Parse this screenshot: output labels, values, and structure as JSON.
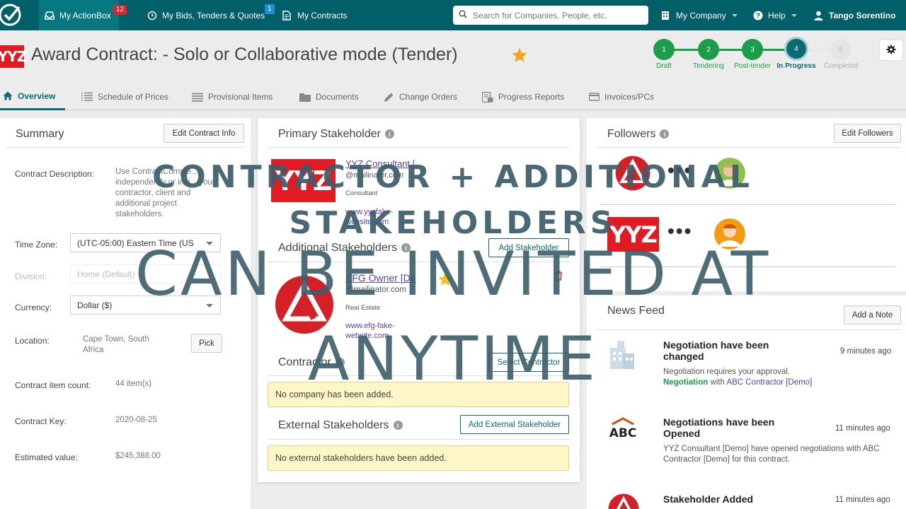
{
  "nav": {
    "action_box": "My ActionBox",
    "action_box_badge": "12",
    "bids": "My Bids, Tenders & Quotes",
    "bids_badge": "1",
    "contracts": "My Contracts",
    "search_placeholder": "Search for Companies, People, etc.",
    "company": "My Company",
    "help": "Help",
    "user": "Tango Sorentino"
  },
  "header": {
    "logo_text": "YYZ",
    "title": "Award Contract: - Solo or Collaborative mode (Tender)"
  },
  "steps": [
    {
      "num": "1",
      "label": "Draft"
    },
    {
      "num": "2",
      "label": "Tendering"
    },
    {
      "num": "3",
      "label": "Post-tender"
    },
    {
      "num": "4",
      "label": "In Progress"
    },
    {
      "num": "5",
      "label": "Completed"
    }
  ],
  "tabs": {
    "overview": "Overview",
    "schedule": "Schedule of Prices",
    "provisional": "Provisional Items",
    "documents": "Documents",
    "change_orders": "Change Orders",
    "progress": "Progress Reports",
    "invoices": "Invoices/PCs"
  },
  "summary": {
    "title": "Summary",
    "edit_button": "Edit Contract Info",
    "description_label": "Contract Description:",
    "description_value": "Use ContractComple... independently or invi... your contractor, client and additional project stakeholders.",
    "timezone_label": "Time Zone:",
    "timezone_value": "(UTC-05:00) Eastern Time (US",
    "division_label": "Division:",
    "division_value": "Home (Default)",
    "currency_label": "Currency:",
    "currency_value": "Dollar ($)",
    "location_label": "Location:",
    "location_value": "Cape Town, South Africa",
    "pick_button": "Pick",
    "item_count_label": "Contract item count:",
    "item_count_value": "44 item(s)",
    "key_label": "Contract Key:",
    "key_value": "2020-08-25",
    "estimate_label": "Estimated value:",
    "estimate_value": "$245,388.00"
  },
  "primary": {
    "title": "Primary Stakeholder",
    "logo_text": "YYZ",
    "name": "YYZ Consultant [",
    "email": "@mailinator.com",
    "role": "Consultant",
    "website": "www.yyzfake-website.com"
  },
  "additional": {
    "title": "Additional Stakeholders",
    "add_button": "Add Stakeholder",
    "name": "EFG Owner [De",
    "email": "@mailinator.com",
    "role": "Real Estate",
    "website": "www.efg-fake-website.com"
  },
  "contractor": {
    "title": "Contractor",
    "select_button": "Select Contractor",
    "empty": "No company has been added."
  },
  "external": {
    "title": "External Stakeholders",
    "add_button": "Add External Stakeholder",
    "empty": "No external stakeholders have been added."
  },
  "followers": {
    "title": "Followers",
    "edit_button": "Edit Followers",
    "logo_text": "YYZ"
  },
  "news": {
    "title": "News Feed",
    "add_button": "Add a Note",
    "items": [
      {
        "title": "Negotiation have been changed",
        "time": "9 minutes ago",
        "body_1": "Negotiation requires your approval.",
        "body_green": "Negotiation",
        "body_with": " with ",
        "body_link": "ABC Contractor [Demo]"
      },
      {
        "title": "Negotiations have been Opened",
        "time": "11 minutes ago",
        "body": "YYZ Consultant [Demo] have opened negotiations with ABC Contractor [Demo] for this contract.",
        "logo_text": "ABC"
      },
      {
        "title": "Stakeholder Added",
        "time": "11 minutes ago"
      }
    ]
  },
  "caption": {
    "line1": "CONTRACTOR + ADDITIONAL",
    "line2": "STAKEHOLDERS",
    "line3": "CAN BE INVITED AT",
    "line4": "ANYTIME"
  }
}
